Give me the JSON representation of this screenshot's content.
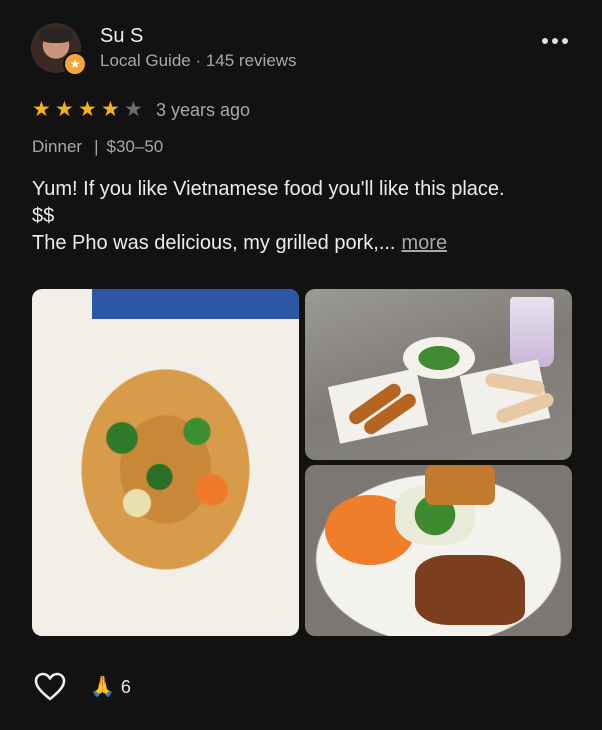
{
  "reviewer": {
    "name": "Su S",
    "meta": "Local Guide · 145 reviews",
    "avatar_icon": "person-avatar",
    "badge_icon": "local-guide-star-badge"
  },
  "review": {
    "rating": 4,
    "max_rating": 5,
    "date": "3 years ago",
    "meal_type": "Dinner",
    "separator": "|",
    "price": "$30–50",
    "text_line1": "Yum! If you like Vietnamese food you'll like this place.",
    "text_line2": "$$",
    "text_line3": "The Pho was delicious, my grilled pork,...",
    "more_label": "more"
  },
  "photos": [
    {
      "icon": "pho-bowl-photo"
    },
    {
      "icon": "egg-rolls-and-spring-rolls-photo"
    },
    {
      "icon": "grilled-pork-vermicelli-photo"
    }
  ],
  "actions": {
    "like_icon": "heart-outline-icon",
    "thanks_icon": "praying-hands-icon",
    "thanks_count": "6"
  },
  "colors": {
    "background": "#121212",
    "star": "#f6b21a",
    "star_off": "#6e6e6e",
    "secondary_text": "#a8a8a8"
  }
}
